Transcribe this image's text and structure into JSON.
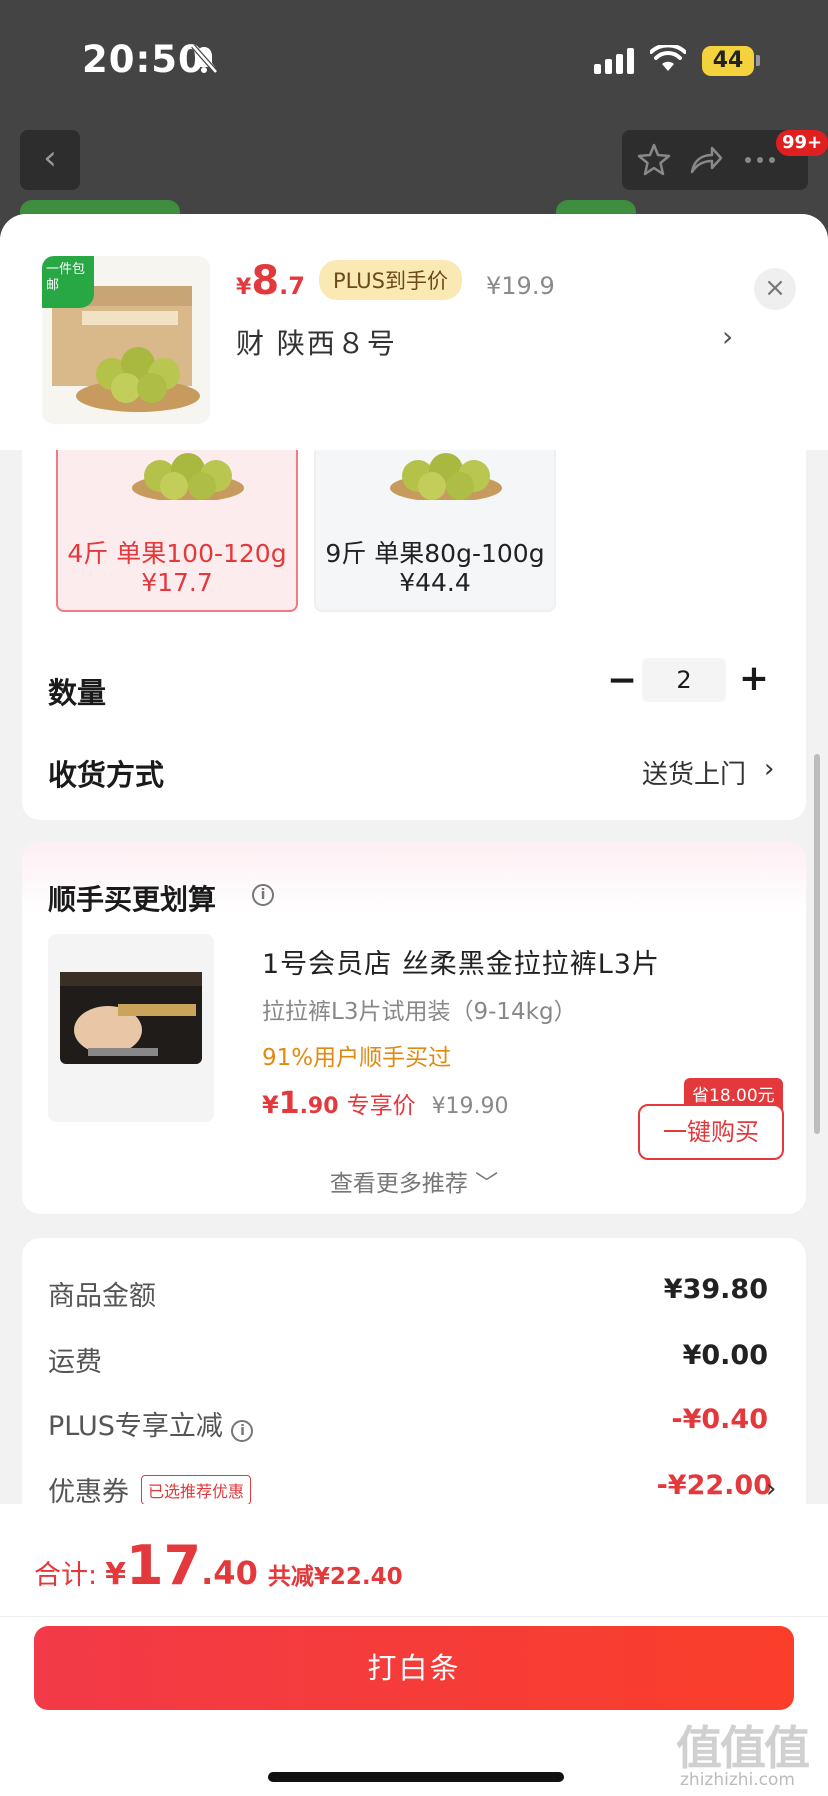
{
  "status_bar": {
    "time": "20:50",
    "battery": "44"
  },
  "nav": {
    "notification_count": "99+"
  },
  "product": {
    "thumb_tag": "一件包邮",
    "price_yen": "¥",
    "price_int": "8",
    "price_dec": ".7",
    "plus_label": "PLUS到手价",
    "original_price": "¥19.9",
    "selected_spec": "财  陕西８号"
  },
  "variants": [
    {
      "name": "4斤 单果100-120g",
      "price": "¥17.7",
      "selected": true
    },
    {
      "name": "9斤 单果80g-100g",
      "price": "¥44.4",
      "selected": false
    }
  ],
  "quantity": {
    "label": "数量",
    "value": "2"
  },
  "delivery": {
    "label": "收货方式",
    "value": "送货上门"
  },
  "recommend": {
    "title": "顺手买更划算",
    "item_name": "1号会员店 丝柔黑金拉拉裤L3片",
    "item_sub": "拉拉裤L3片试用装（9-14kg）",
    "item_stat": "91%用户顺手买过",
    "price_yen": "¥",
    "price_int": "1",
    "price_dec": ".90",
    "price_label": "专享价",
    "original_price": "¥19.90",
    "save_chip": "省18.00元",
    "buy_label": "一键购买",
    "more_label": "查看更多推荐 ﹀"
  },
  "summary": [
    {
      "label": "商品金额",
      "value": "¥39.80",
      "red": false
    },
    {
      "label": "运费",
      "value": "¥0.00",
      "red": false
    },
    {
      "label": "PLUS专享立减",
      "value": "-¥0.40",
      "red": true
    },
    {
      "label": "优惠券",
      "value": "-¥22.00",
      "red": true,
      "tag": "已选推荐优惠"
    }
  ],
  "total": {
    "label": "合计:",
    "yen": "¥",
    "int": "17",
    "dec": ".40",
    "saved": "共减¥22.40"
  },
  "pay_button": "打白条",
  "watermark": {
    "main": "值值值",
    "sub": "zhizhizhi.com"
  },
  "colors": {
    "accent_red": "#e4393c",
    "plus_gold": "#fbe9b4",
    "stat_orange": "#e08a10"
  }
}
